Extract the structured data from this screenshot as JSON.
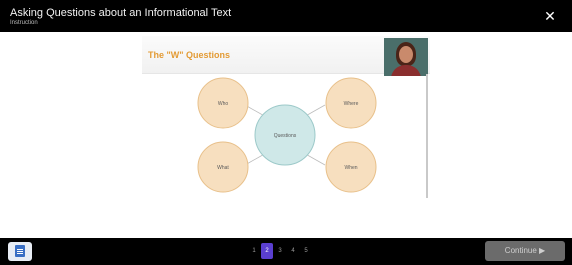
{
  "header": {
    "title": "Asking Questions about an Informational Text",
    "subtitle": "Instruction",
    "close_label": "✕"
  },
  "slide": {
    "title": "The \"W\" Questions",
    "center_node": "Questions",
    "nodes": [
      "Who",
      "Where",
      "What",
      "When"
    ],
    "colors": {
      "outer_fill": "#f7dfbf",
      "outer_stroke": "#e8c08a",
      "center_fill": "#cfe8e8",
      "center_stroke": "#9cc9c9",
      "title": "#e39b35"
    }
  },
  "footer": {
    "menu_icon": "document-list-icon",
    "pages": [
      "1",
      "2",
      "3",
      "4",
      "5"
    ],
    "active_page": "2",
    "continue_label": "Continue ▶"
  }
}
